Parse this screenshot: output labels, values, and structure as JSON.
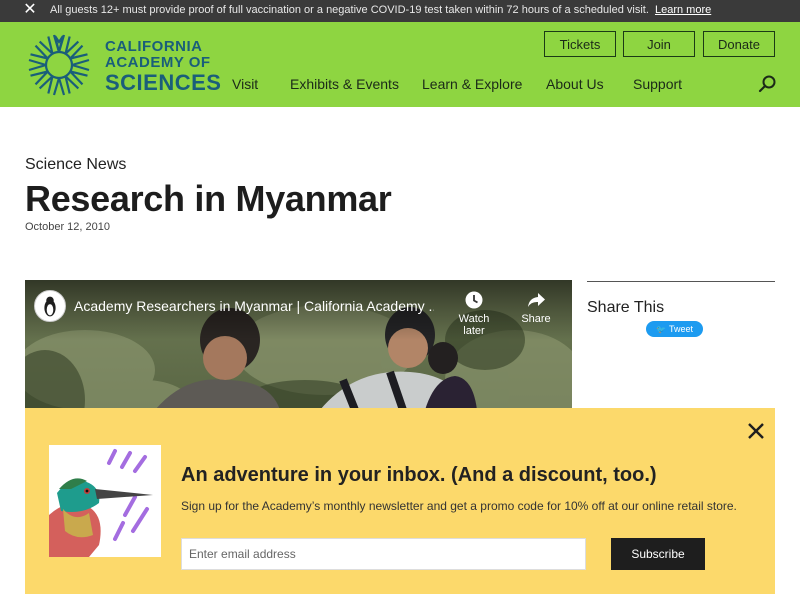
{
  "alert": {
    "text": "All guests 12+ must provide proof of full vaccination or a negative COVID-19 test taken within 72 hours of a scheduled visit.",
    "link": "Learn more"
  },
  "logo": {
    "line1": "CALIFORNIA",
    "line2": "ACADEMY OF",
    "line3": "SCIENCES"
  },
  "top_buttons": {
    "tickets": "Tickets",
    "join": "Join",
    "donate": "Donate"
  },
  "nav": [
    "Visit",
    "Exhibits & Events",
    "Learn & Explore",
    "About Us",
    "Support"
  ],
  "article": {
    "kicker": "Science News",
    "title": "Research in Myanmar",
    "date": "October 12, 2010"
  },
  "video": {
    "title": "Academy Researchers in Myanmar | California Academy ...",
    "watch_later": "Watch later",
    "share": "Share"
  },
  "share": {
    "title": "Share This",
    "tweet": "Tweet"
  },
  "newsletter": {
    "heading": "An adventure in your inbox. (And a discount, too.)",
    "text": "Sign up for the Academy’s monthly newsletter and get a promo code for 10% off at our online retail store.",
    "placeholder": "Enter email address",
    "subscribe": "Subscribe"
  },
  "colors": {
    "header_green": "#8ed541",
    "logo_blue": "#1a5e7a",
    "alert_bg": "#3a3a3a",
    "modal_yellow": "#fcd96b",
    "tweet_blue": "#1d9bf0"
  },
  "icons": [
    "close-icon",
    "search-icon",
    "academy-logo-icon",
    "clock-icon",
    "share-arrow-icon",
    "penguin-avatar-icon",
    "bird-illustration"
  ]
}
